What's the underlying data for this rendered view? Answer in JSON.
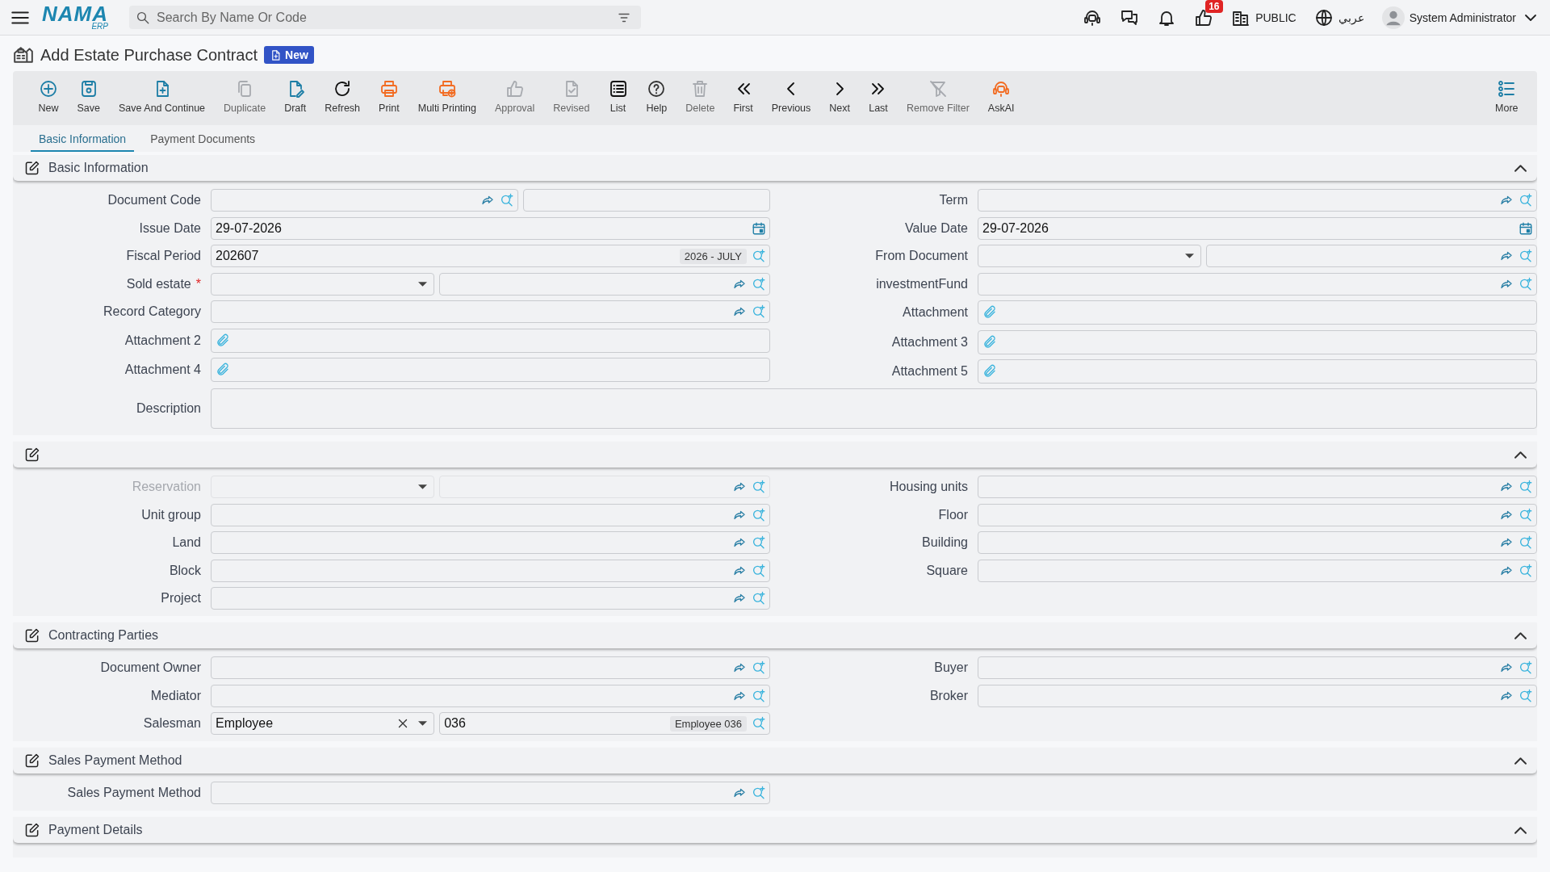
{
  "topbar": {
    "logo": "NAMA",
    "logo_sub": "ERP",
    "search": {
      "placeholder": "Search By Name Or Code"
    },
    "notifications_badge": "16",
    "branch": "PUBLIC",
    "language": "عربي",
    "user": "System Administrator"
  },
  "page": {
    "title": "Add Estate Purchase Contract",
    "badge": "New"
  },
  "toolbar": [
    {
      "kind": "new",
      "label": "New",
      "disabled": false
    },
    {
      "kind": "save",
      "label": "Save",
      "disabled": false
    },
    {
      "kind": "save_continue",
      "label": "Save And Continue",
      "disabled": false
    },
    {
      "kind": "duplicate",
      "label": "Duplicate",
      "disabled": true
    },
    {
      "kind": "draft",
      "label": "Draft",
      "disabled": false
    },
    {
      "kind": "refresh",
      "label": "Refresh",
      "disabled": false
    },
    {
      "kind": "print",
      "label": "Print",
      "disabled": false
    },
    {
      "kind": "multi_print",
      "label": "Multi Printing",
      "disabled": false
    },
    {
      "kind": "approval",
      "label": "Approval",
      "disabled": true
    },
    {
      "kind": "revised",
      "label": "Revised",
      "disabled": true
    },
    {
      "kind": "list",
      "label": "List",
      "disabled": false
    },
    {
      "kind": "help",
      "label": "Help",
      "disabled": false
    },
    {
      "kind": "delete",
      "label": "Delete",
      "disabled": true
    },
    {
      "kind": "first",
      "label": "First",
      "disabled": false
    },
    {
      "kind": "previous",
      "label": "Previous",
      "disabled": false
    },
    {
      "kind": "next",
      "label": "Next",
      "disabled": false
    },
    {
      "kind": "last",
      "label": "Last",
      "disabled": false
    },
    {
      "kind": "remove_filter",
      "label": "Remove Filter",
      "disabled": true
    },
    {
      "kind": "ask_ai",
      "label": "AskAI",
      "disabled": false
    },
    {
      "kind": "more",
      "label": "More",
      "disabled": false
    }
  ],
  "tabs": [
    {
      "label": "Basic Information",
      "selected": true
    },
    {
      "label": "Payment Documents",
      "selected": false
    }
  ],
  "sections": [
    {
      "title": "Basic Information",
      "expanded": true,
      "left": [
        {
          "label": "Document Code",
          "kind": "code"
        },
        {
          "label": "Issue Date",
          "kind": "date",
          "value": "29-07-2026"
        },
        {
          "label": "Fiscal Period",
          "kind": "period",
          "value": "202607",
          "tag": "2026 - JULY"
        },
        {
          "label": "Sold estate",
          "kind": "select_lookup",
          "required_mark": "*"
        },
        {
          "label": "Record Category",
          "kind": "lookup"
        },
        {
          "label": "Attachment 2",
          "kind": "attachment"
        },
        {
          "label": "Attachment 4",
          "kind": "attachment"
        }
      ],
      "right": [
        {
          "label": "Term",
          "kind": "lookup"
        },
        {
          "label": "Value Date",
          "kind": "date",
          "value": "29-07-2026"
        },
        {
          "label": "From Document",
          "kind": "select_lookup"
        },
        {
          "label": "investmentFund",
          "kind": "lookup"
        },
        {
          "label": "Attachment",
          "kind": "attachment"
        },
        {
          "label": "Attachment 3",
          "kind": "attachment"
        },
        {
          "label": "Attachment 5",
          "kind": "attachment"
        }
      ],
      "wide": [
        {
          "label": "Description",
          "kind": "textarea"
        }
      ]
    },
    {
      "expanded": true,
      "left": [
        {
          "label": "Reservation",
          "kind": "select_lookup",
          "disabled": true
        },
        {
          "label": "Unit group",
          "kind": "lookup"
        },
        {
          "label": "Land",
          "kind": "lookup"
        },
        {
          "label": "Block",
          "kind": "lookup"
        },
        {
          "label": "Project",
          "kind": "lookup"
        }
      ],
      "right": [
        {
          "label": "Housing units",
          "kind": "lookup"
        },
        {
          "label": "Floor",
          "kind": "lookup"
        },
        {
          "label": "Building",
          "kind": "lookup"
        },
        {
          "label": "Square",
          "kind": "lookup"
        }
      ]
    },
    {
      "title": "Contracting Parties",
      "expanded": true,
      "left": [
        {
          "label": "Document Owner",
          "kind": "lookup"
        },
        {
          "label": "Mediator",
          "kind": "lookup"
        },
        {
          "label": "Salesman",
          "kind": "select_lookup",
          "value": "Employee",
          "value2": "036",
          "tag": "Employee 036"
        }
      ],
      "right": [
        {
          "label": "Buyer",
          "kind": "lookup"
        },
        {
          "label": "Broker",
          "kind": "lookup"
        }
      ]
    },
    {
      "title": "Sales Payment Method",
      "expanded": true,
      "left": [
        {
          "label": "Sales Payment Method",
          "kind": "lookup"
        }
      ]
    },
    {
      "title": "Payment Details",
      "expanded": true
    }
  ]
}
